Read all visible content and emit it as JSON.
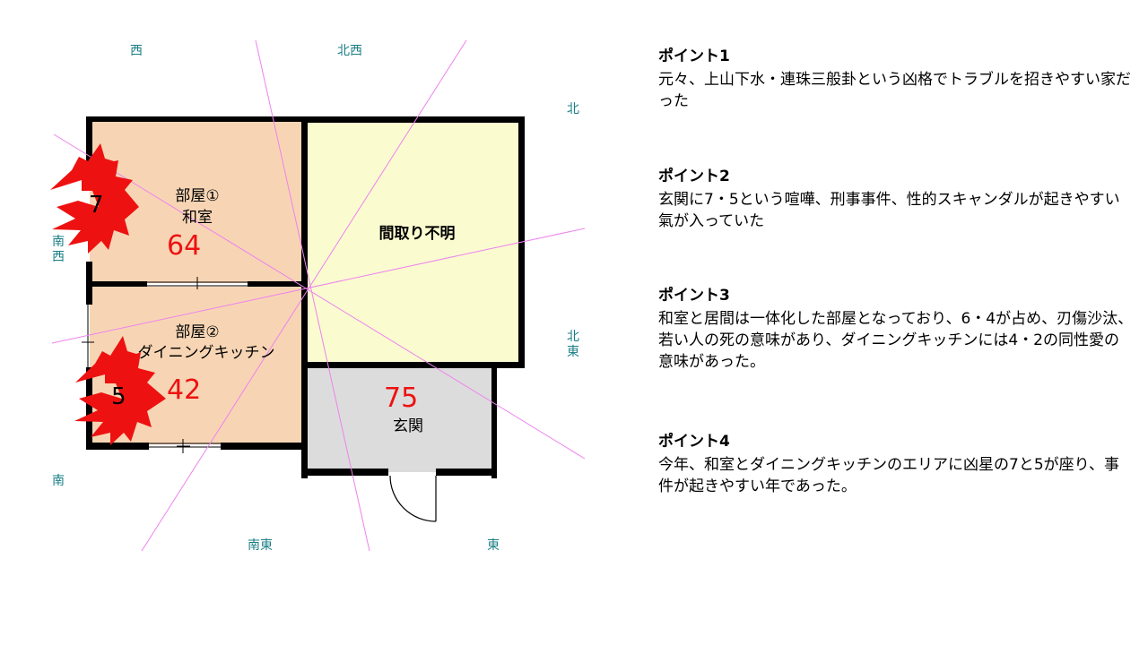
{
  "directions": {
    "west": "西",
    "northwest": "北西",
    "north": "北",
    "southwest": "南西",
    "northeast": "北東",
    "south": "南",
    "southeast": "南東",
    "east": "東"
  },
  "rooms": {
    "room1_name": "部屋①",
    "room1_type": "和室",
    "room1_number": "64",
    "room2_name": "部屋②",
    "room2_type": "ダイニングキッチン",
    "room2_number": "42",
    "unknown_room": "間取り不明",
    "entrance": "玄関",
    "entrance_number": "75"
  },
  "stars": {
    "star1_number": "7",
    "star2_number": "5"
  },
  "points": [
    {
      "title": "ポイント1",
      "body": "元々、上山下水・連珠三般卦という凶格でトラブルを招きやすい家だった"
    },
    {
      "title": "ポイント2",
      "body": "玄関に7・5という喧嘩、刑事事件、性的スキャンダルが起きやすい氣が入っていた"
    },
    {
      "title": "ポイント3",
      "body": "和室と居間は一体化した部屋となっており、6・4が占め、刃傷沙汰、若い人の死の意味があり、ダイニングキッチンには4・2の同性愛の意味があった。"
    },
    {
      "title": "ポイント4",
      "body": "今年、和室とダイニングキッチンのエリアに凶星の7と5が座り、事件が起きやすい年であった。"
    }
  ],
  "colors": {
    "room_fill": "#f7d5b4",
    "unknown_fill": "#fbfbd0",
    "entrance_fill": "#dcdcdc",
    "wall": "#000000",
    "direction_text": "#1a7f86",
    "sector_line": "#ee82ee",
    "star_fill": "#ee1111",
    "number_red": "#ee1111"
  }
}
